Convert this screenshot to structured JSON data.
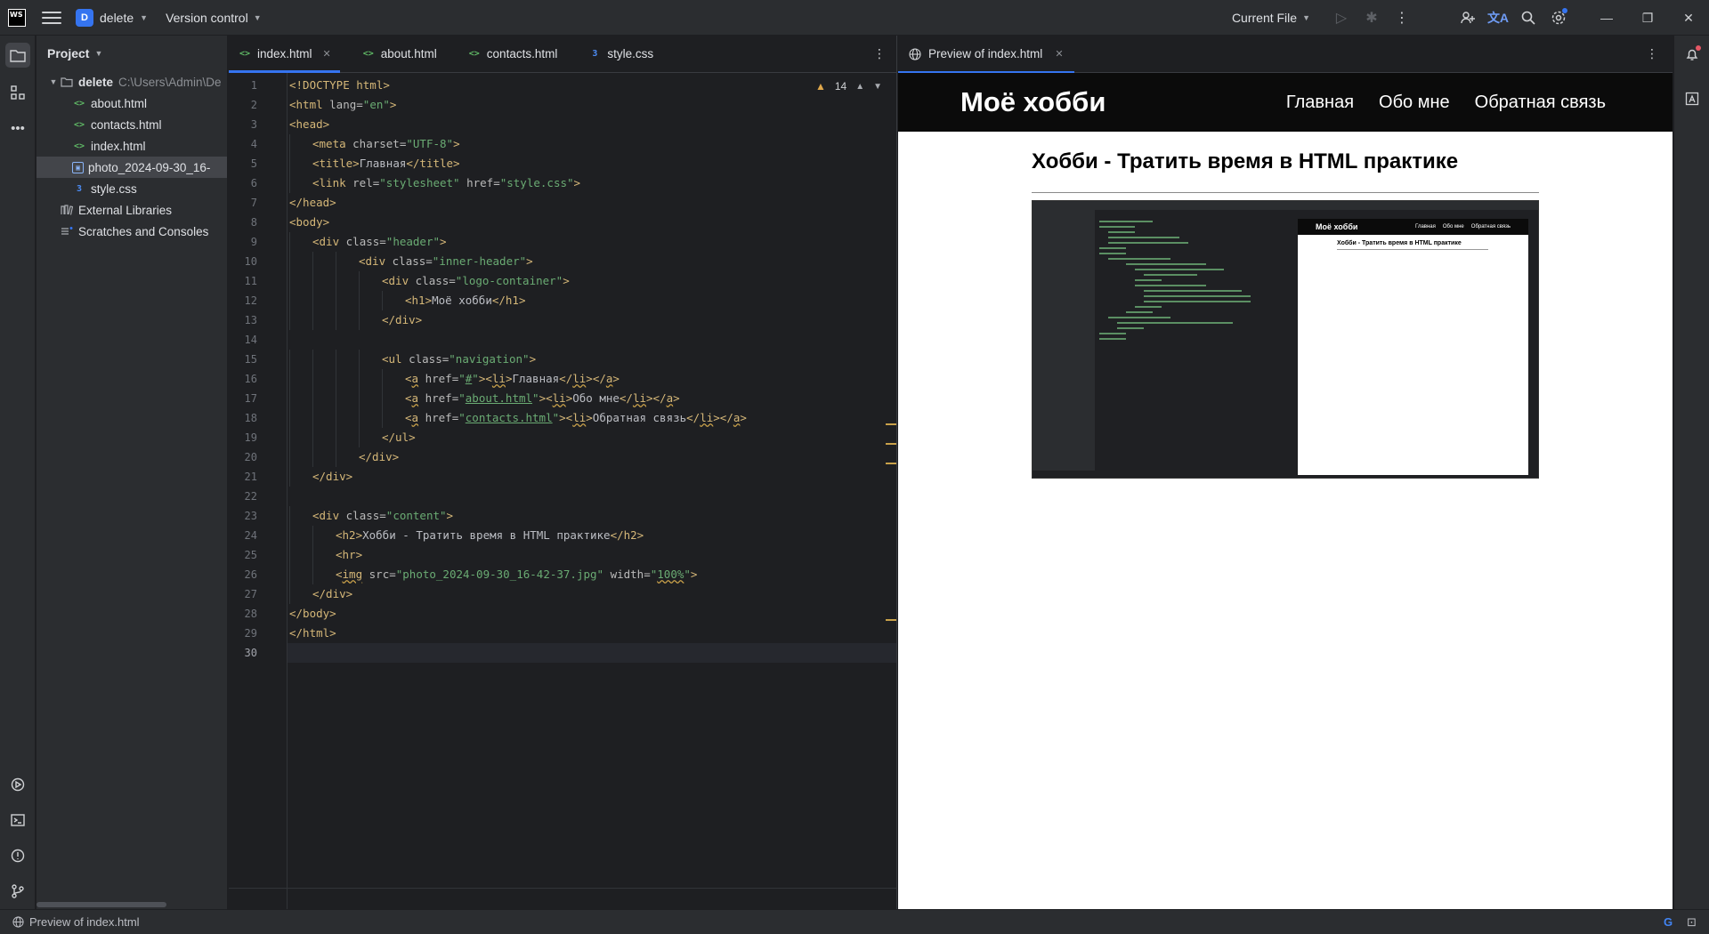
{
  "titlebar": {
    "app_logo": "WS",
    "project_badge": "D",
    "project_name": "delete",
    "vcs_label": "Version control",
    "run_config": "Current File",
    "icons": [
      "run-icon",
      "debug-icon",
      "more-icon",
      "add-user-icon",
      "translate-icon",
      "search-icon",
      "settings-icon",
      "minimize-icon",
      "restore-icon",
      "close-icon"
    ]
  },
  "project_panel": {
    "title": "Project",
    "root": {
      "name": "delete",
      "path": "C:\\Users\\Admin\\De"
    },
    "files": [
      {
        "name": "about.html",
        "type": "html"
      },
      {
        "name": "contacts.html",
        "type": "html"
      },
      {
        "name": "index.html",
        "type": "html"
      },
      {
        "name": "photo_2024-09-30_16-",
        "type": "img",
        "selected": true
      },
      {
        "name": "style.css",
        "type": "css"
      }
    ],
    "external_libraries": "External Libraries",
    "scratches": "Scratches and Consoles"
  },
  "editor": {
    "tabs": [
      {
        "label": "index.html",
        "type": "html",
        "active": true
      },
      {
        "label": "about.html",
        "type": "html"
      },
      {
        "label": "contacts.html",
        "type": "html"
      },
      {
        "label": "style.css",
        "type": "css"
      }
    ],
    "warnings_count": "14",
    "current_line": 30,
    "lines": [
      {
        "n": "1",
        "i": 0,
        "h": "<span class='t'>&lt;!DOCTYPE html&gt;</span>"
      },
      {
        "n": "2",
        "i": 0,
        "h": "<span class='t'>&lt;html </span><span class='a'>lang=</span><span class='v'>\"en\"</span><span class='t'>&gt;</span>"
      },
      {
        "n": "3",
        "i": 0,
        "h": "<span class='t'>&lt;head&gt;</span>"
      },
      {
        "n": "4",
        "i": 1,
        "h": "<span class='t'>&lt;meta </span><span class='a'>charset=</span><span class='v'>\"UTF-8\"</span><span class='t'>&gt;</span>"
      },
      {
        "n": "5",
        "i": 1,
        "h": "<span class='t'>&lt;title&gt;</span><span class='p'>Главная</span><span class='t'>&lt;/title&gt;</span>"
      },
      {
        "n": "6",
        "i": 1,
        "h": "<span class='t'>&lt;link </span><span class='a'>rel=</span><span class='v'>\"stylesheet\"</span><span class='a'> href=</span><span class='v'>\"style.css\"</span><span class='t'>&gt;</span>"
      },
      {
        "n": "7",
        "i": 0,
        "h": "<span class='t'>&lt;/head&gt;</span>"
      },
      {
        "n": "8",
        "i": 0,
        "h": "<span class='t'>&lt;body&gt;</span>"
      },
      {
        "n": "9",
        "i": 1,
        "h": "<span class='t'>&lt;div </span><span class='a'>class=</span><span class='v'>\"header\"</span><span class='t'>&gt;</span>"
      },
      {
        "n": "10",
        "i": 3,
        "h": "<span class='t'>&lt;div </span><span class='a'>class=</span><span class='v'>\"inner-header\"</span><span class='t'>&gt;</span>"
      },
      {
        "n": "11",
        "i": 4,
        "h": "<span class='t'>&lt;div </span><span class='a'>class=</span><span class='v'>\"logo-container\"</span><span class='t'>&gt;</span>"
      },
      {
        "n": "12",
        "i": 5,
        "h": "<span class='t'>&lt;h1&gt;</span><span class='p'>Моё хобби</span><span class='t'>&lt;/h1&gt;</span>"
      },
      {
        "n": "13",
        "i": 4,
        "h": "<span class='t'>&lt;/div&gt;</span>"
      },
      {
        "n": "14",
        "i": 0,
        "h": ""
      },
      {
        "n": "15",
        "i": 4,
        "h": "<span class='t'>&lt;ul </span><span class='a'>class=</span><span class='v'>\"navigation\"</span><span class='t'>&gt;</span>"
      },
      {
        "n": "16",
        "i": 5,
        "h": "<span class='t'>&lt;<span class='w'>a</span> </span><span class='a'>href=</span><span class='v'>\"<span class='u'>#</span>\"</span><span class='t'>&gt;&lt;<span class='w'>li</span>&gt;</span><span class='p'>Главная</span><span class='t'>&lt;/<span class='w'>li</span>&gt;&lt;/<span class='w'>a</span>&gt;</span>"
      },
      {
        "n": "17",
        "i": 5,
        "h": "<span class='t'>&lt;<span class='w'>a</span> </span><span class='a'>href=</span><span class='v'>\"<span class='u'>about.html</span>\"</span><span class='t'>&gt;&lt;<span class='w'>li</span>&gt;</span><span class='p'>Обо мне</span><span class='t'>&lt;/<span class='w'>li</span>&gt;&lt;/<span class='w'>a</span>&gt;</span>"
      },
      {
        "n": "18",
        "i": 5,
        "h": "<span class='t'>&lt;<span class='w'>a</span> </span><span class='a'>href=</span><span class='v'>\"<span class='u'>contacts.html</span>\"</span><span class='t'>&gt;&lt;<span class='w'>li</span>&gt;</span><span class='p'>Обратная связь</span><span class='t'>&lt;/<span class='w'>li</span>&gt;&lt;/<span class='w'>a</span>&gt;</span>"
      },
      {
        "n": "19",
        "i": 4,
        "h": "<span class='t'>&lt;/ul&gt;</span>"
      },
      {
        "n": "20",
        "i": 3,
        "h": "<span class='t'>&lt;/div&gt;</span>"
      },
      {
        "n": "21",
        "i": 1,
        "h": "<span class='t'>&lt;/div&gt;</span>"
      },
      {
        "n": "22",
        "i": 0,
        "h": ""
      },
      {
        "n": "23",
        "i": 1,
        "h": "<span class='t'>&lt;div </span><span class='a'>class=</span><span class='v'>\"content\"</span><span class='t'>&gt;</span>"
      },
      {
        "n": "24",
        "i": 2,
        "h": "<span class='t'>&lt;h2&gt;</span><span class='p'>Хобби - Тратить время в HTML практике</span><span class='t'>&lt;/h2&gt;</span>"
      },
      {
        "n": "25",
        "i": 2,
        "h": "<span class='t'>&lt;hr&gt;</span>"
      },
      {
        "n": "26",
        "i": 2,
        "h": "<span class='t'>&lt;<span class='w'>img</span> </span><span class='a'>src=</span><span class='v'>\"photo_2024-09-30_16-42-37.jpg\"</span><span class='a'> width=</span><span class='v'>\"<span class='w'>100%</span>\"</span><span class='t'>&gt;</span>"
      },
      {
        "n": "27",
        "i": 1,
        "h": "<span class='t'>&lt;/div&gt;</span>"
      },
      {
        "n": "28",
        "i": 0,
        "h": "<span class='t'>&lt;/body&gt;</span>"
      },
      {
        "n": "29",
        "i": 0,
        "h": "<span class='t'>&lt;/html&gt;</span>"
      },
      {
        "n": "30",
        "i": 0,
        "h": ""
      }
    ]
  },
  "preview": {
    "tab_label": "Preview of index.html",
    "site": {
      "logo": "Моё хобби",
      "nav": [
        "Главная",
        "Обо мне",
        "Обратная связь"
      ],
      "heading": "Хобби - Тратить время в HTML практике"
    },
    "thumb": {
      "logo": "Моё хобби",
      "nav": [
        "Главная",
        "Обо мне",
        "Обратная связь"
      ],
      "heading": "Хобби - Тратить время в HTML практике"
    }
  },
  "statusbar": {
    "label": "Preview of index.html"
  },
  "colors": {
    "accent": "#3574f0",
    "tag": "#d5b778",
    "string": "#6aab73",
    "warning": "#e0a84b"
  }
}
